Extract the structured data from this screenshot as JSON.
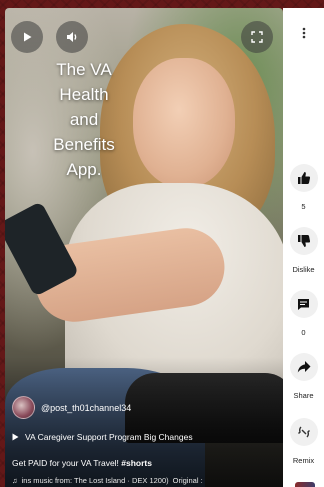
{
  "video": {
    "overlay_lines": [
      "The VA",
      "Health",
      "and",
      "Benefits",
      "App."
    ],
    "channel": "@post_th01channel34",
    "caption_line1": "VA Caregiver Support Program  Big Changes",
    "caption_line2_prefix": "Get PAID for your VA Travel! ",
    "caption_line2_tag": "#shorts",
    "music_text": "ins music from: The Lost Island · DEX 1200)",
    "music_suffix": "Original :"
  },
  "actions": {
    "like_count": "5",
    "dislike_label": "Dislike",
    "comment_count": "0",
    "share_label": "Share",
    "remix_label": "Remix"
  },
  "icons": {
    "play": "play-icon",
    "volume": "volume-icon",
    "fullscreen": "fullscreen-icon",
    "more": "more-vertical-icon",
    "like": "thumbs-up-icon",
    "dislike": "thumbs-down-icon",
    "comment": "comment-icon",
    "share": "share-icon",
    "remix": "remix-icon",
    "music": "music-note-icon"
  },
  "colors": {
    "background": "#641818",
    "sidebar": "#ffffff",
    "overlay_text": "#ffffff"
  }
}
